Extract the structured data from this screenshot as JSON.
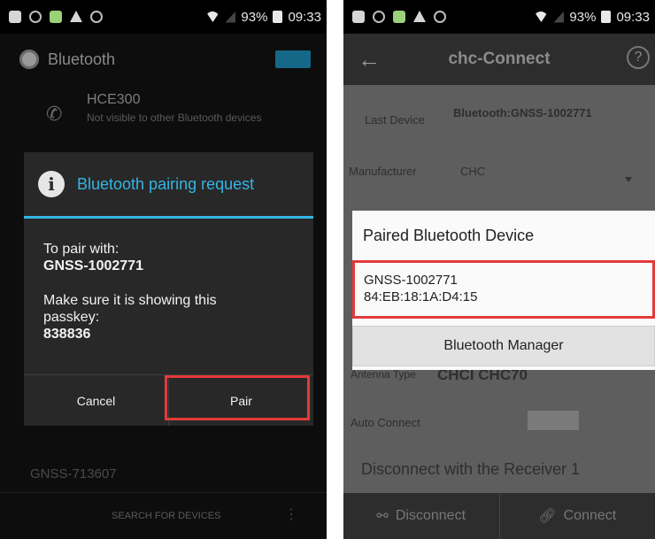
{
  "status_bar": {
    "battery": "93%",
    "time": "09:33"
  },
  "left": {
    "header_title": "Bluetooth",
    "device": {
      "name": "HCE300",
      "subtitle": "Not visible to other Bluetooth devices"
    },
    "dialog": {
      "title": "Bluetooth pairing request",
      "line1": "To pair with:",
      "device_name": "GNSS-1002771",
      "line2": "Make sure it is showing this passkey:",
      "passkey": "838836",
      "cancel_label": "Cancel",
      "pair_label": "Pair"
    },
    "other_device": "GNSS-713607",
    "search_label": "SEARCH FOR DEVICES"
  },
  "right": {
    "header_title": "chc-Connect",
    "help_label": "?",
    "last_device_label": "Last Device",
    "last_device_value": "Bluetooth:GNSS-1002771",
    "manufacturer_label": "Manufacturer",
    "manufacturer_value": "CHC",
    "antenna_label": "Antenna Type",
    "antenna_value": "CHCI CHC70",
    "auto_connect_label": "Auto Connect",
    "disconnect_receiver": "Disconnect with the Receiver 1",
    "popup": {
      "title": "Paired Bluetooth Device",
      "device_name": "GNSS-1002771",
      "device_mac": "84:EB:18:1A:D4:15",
      "manager_label": "Bluetooth Manager"
    },
    "disconnect_label": "Disconnect",
    "connect_label": "Connect"
  }
}
